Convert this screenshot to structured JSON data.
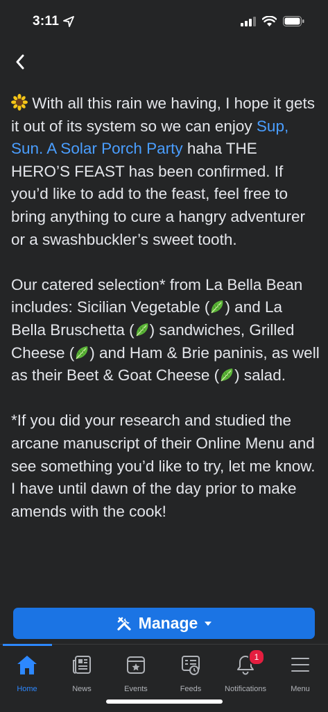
{
  "status_bar": {
    "time": "3:11"
  },
  "post": {
    "paragraph1_prefix": "With all this rain we having, I hope it gets it out of its system so we can enjoy",
    "link_text": "Sup, Sun. A Solar Porch Party",
    "paragraph1_suffix": "haha THE HERO’S FEAST has been confirmed. If you’d like to add to the feast, feel free to bring anything to cure a hangry adventurer or a swashbuckler’s sweet tooth.",
    "paragraph2": {
      "part1": "Our catered selection* from La Bella Bean includes: Sicilian Vegetable (",
      "part2": ") and La Bella Bruschetta (",
      "part3": ") sandwiches, Grilled Cheese (",
      "part4": ") and Ham & Brie paninis, as well as their Beet & Goat Cheese (",
      "part5": ") salad."
    },
    "paragraph3": "*If you did your research and studied the arcane manuscript of their Online Menu and see something you’d like to try, let me know. I have until dawn of the day prior to make amends with the cook!"
  },
  "manage_button": {
    "label": "Manage"
  },
  "tabs": [
    {
      "label": "Home",
      "icon": "home-icon",
      "active": true
    },
    {
      "label": "News",
      "icon": "news-icon"
    },
    {
      "label": "Events",
      "icon": "events-icon"
    },
    {
      "label": "Feeds",
      "icon": "feeds-icon"
    },
    {
      "label": "Notifications",
      "icon": "bell-icon",
      "badge": "1"
    },
    {
      "label": "Menu",
      "icon": "menu-icon"
    }
  ],
  "colors": {
    "accent": "#2d88ff",
    "button": "#1b74e4",
    "background": "#242526",
    "badge": "#e41e3f"
  }
}
